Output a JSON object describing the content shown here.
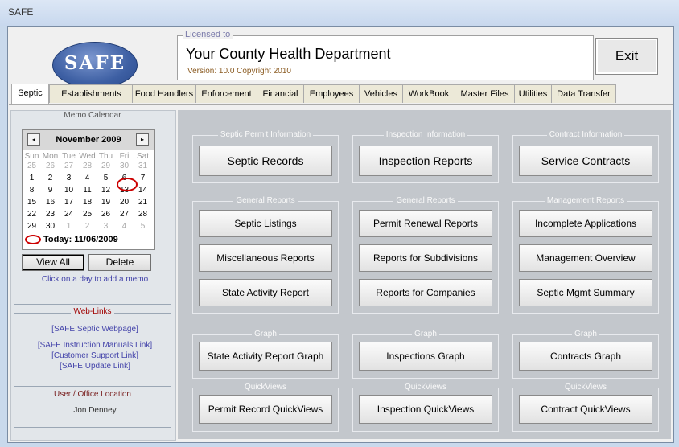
{
  "window": {
    "title": "SAFE"
  },
  "logo": {
    "text": "SAFE"
  },
  "license": {
    "caption": "Licensed to",
    "department": "Your County Health Department",
    "version": "Version: 10.0  Copyright 2010"
  },
  "exit_label": "Exit",
  "tabs": [
    "Septic",
    "Establishments",
    "Food Handlers",
    "Enforcement",
    "Financial",
    "Employees",
    "Vehicles",
    "WorkBook",
    "Master Files",
    "Utilities",
    "Data Transfer"
  ],
  "memo_calendar": {
    "caption": "Memo Calendar",
    "month": "November 2009",
    "prev": "◂",
    "next": "▸",
    "weekdays": [
      "Sun",
      "Mon",
      "Tue",
      "Wed",
      "Thu",
      "Fri",
      "Sat"
    ],
    "weeks": [
      [
        "25",
        "26",
        "27",
        "28",
        "29",
        "30",
        "31"
      ],
      [
        "1",
        "2",
        "3",
        "4",
        "5",
        "6",
        "7"
      ],
      [
        "8",
        "9",
        "10",
        "11",
        "12",
        "13",
        "14"
      ],
      [
        "15",
        "16",
        "17",
        "18",
        "19",
        "20",
        "21"
      ],
      [
        "22",
        "23",
        "24",
        "25",
        "26",
        "27",
        "28"
      ],
      [
        "29",
        "30",
        "1",
        "2",
        "3",
        "4",
        "5"
      ]
    ],
    "today_label": "Today: 11/06/2009",
    "view_all": "View All",
    "delete": "Delete",
    "hint": "Click on a day to add a memo"
  },
  "web_links": {
    "caption": "Web-Links",
    "links": [
      "[SAFE Septic Webpage]",
      "[SAFE Instruction Manuals Link]",
      "[Customer Support Link]",
      "[SAFE Update Link]"
    ]
  },
  "user_location": {
    "caption": "User / Office Location",
    "name": "Jon Denney"
  },
  "groups": {
    "septic_permit": {
      "caption": "Septic Permit Information",
      "button": "Septic Records"
    },
    "inspection": {
      "caption": "Inspection Information",
      "button": "Inspection Reports"
    },
    "contract": {
      "caption": "Contract Information",
      "button": "Service Contracts"
    },
    "general1": {
      "caption": "General Reports",
      "buttons": [
        "Septic Listings",
        "Miscellaneous Reports",
        "State Activity Report"
      ]
    },
    "general2": {
      "caption": "General Reports",
      "buttons": [
        "Permit Renewal Reports",
        "Reports for Subdivisions",
        "Reports for Companies"
      ]
    },
    "management": {
      "caption": "Management Reports",
      "buttons": [
        "Incomplete Applications",
        "Management Overview",
        "Septic Mgmt Summary"
      ]
    },
    "graph1": {
      "caption": "Graph",
      "button": "State Activity Report Graph"
    },
    "graph2": {
      "caption": "Graph",
      "button": "Inspections Graph"
    },
    "graph3": {
      "caption": "Graph",
      "button": "Contracts Graph"
    },
    "quick1": {
      "caption": "QuickViews",
      "button": "Permit Record QuickViews"
    },
    "quick2": {
      "caption": "QuickViews",
      "button": "Inspection QuickViews"
    },
    "quick3": {
      "caption": "QuickViews",
      "button": "Contract QuickViews"
    }
  }
}
